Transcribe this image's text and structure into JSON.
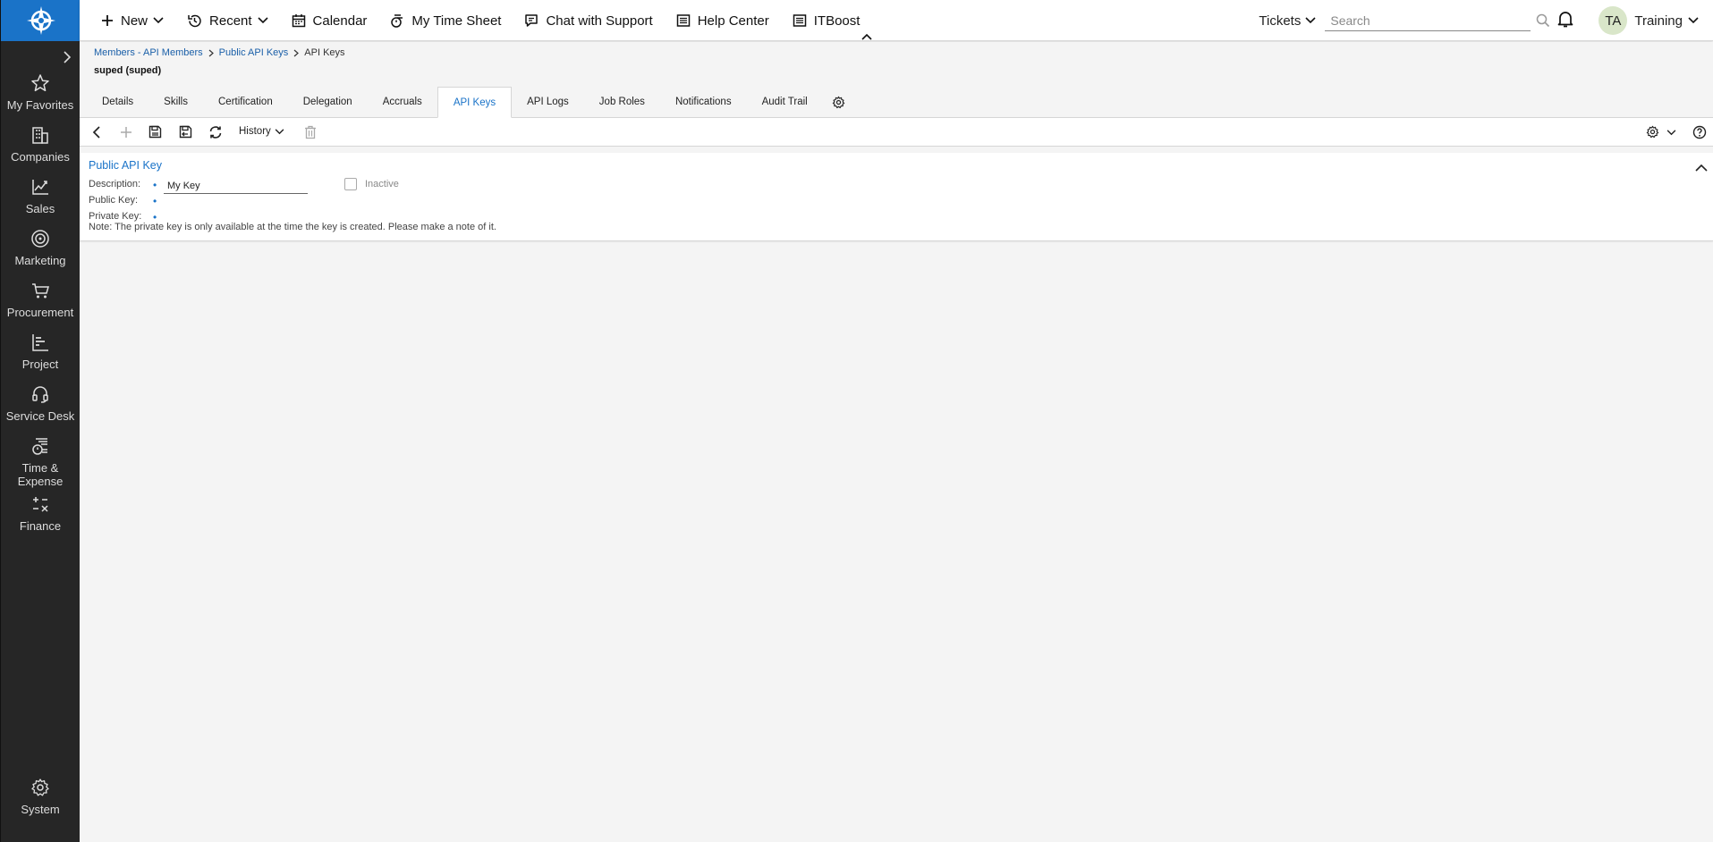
{
  "sidebar": {
    "items": [
      {
        "label": "My Favorites",
        "icon": "star-icon"
      },
      {
        "label": "Companies",
        "icon": "building-icon"
      },
      {
        "label": "Sales",
        "icon": "chart-icon"
      },
      {
        "label": "Marketing",
        "icon": "target-icon"
      },
      {
        "label": "Procurement",
        "icon": "cart-icon"
      },
      {
        "label": "Project",
        "icon": "gantt-icon"
      },
      {
        "label": "Service Desk",
        "icon": "headset-icon"
      },
      {
        "label": "Time & Expense",
        "icon": "stopwatch-icon"
      },
      {
        "label": "Finance",
        "icon": "math-icon"
      }
    ],
    "system": {
      "label": "System",
      "icon": "gear-icon"
    }
  },
  "topbar": {
    "new_label": "New",
    "recent_label": "Recent",
    "calendar_label": "Calendar",
    "timesheet_label": "My Time Sheet",
    "chat_label": "Chat with Support",
    "help_label": "Help Center",
    "itboost_label": "ITBoost",
    "tickets_label": "Tickets",
    "search_placeholder": "Search",
    "avatar_initials": "TA",
    "user_label": "Training"
  },
  "breadcrumb": {
    "items": [
      "Members - API Members",
      "Public API Keys",
      "API Keys"
    ]
  },
  "record_title": "suped (suped)",
  "tabs": {
    "items": [
      "Details",
      "Skills",
      "Certification",
      "Delegation",
      "Accruals",
      "API Keys",
      "API Logs",
      "Job Roles",
      "Notifications",
      "Audit Trail"
    ],
    "active": "API Keys"
  },
  "toolbar": {
    "history_label": "History"
  },
  "panel": {
    "title": "Public API Key",
    "description_label": "Description:",
    "description_value": "My Key",
    "inactive_label": "Inactive",
    "public_key_label": "Public Key:",
    "private_key_label": "Private Key:",
    "required_marker": "•",
    "note": "Note: The private key is only available at the time the key is created. Please make a note of it."
  },
  "colors": {
    "accent": "#1a73c8",
    "sidebar_bg": "#262626",
    "link": "#1a5fa8"
  }
}
